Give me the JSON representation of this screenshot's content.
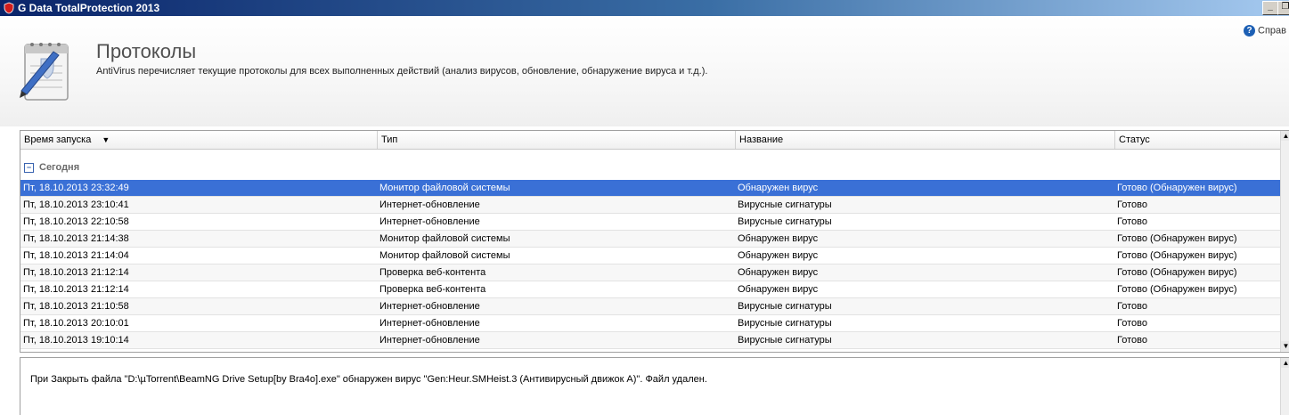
{
  "window": {
    "title": "G Data TotalProtection 2013",
    "icons": {
      "app": "gdata-shield-icon",
      "minimize": "minimize-icon",
      "restore": "restore-icon"
    }
  },
  "header": {
    "title": "Протоколы",
    "description": "AntiVirus перечисляет текущие протоколы для всех выполненных действий (анализ вирусов, обновление, обнаружение вируса и т.д.).",
    "help_label": "Справ",
    "icons": {
      "page": "log-notepad-icon",
      "help": "help-icon"
    }
  },
  "table": {
    "columns": [
      "Время запуска",
      "Тип",
      "Название",
      "Статус"
    ],
    "sorted_column": "Время запуска",
    "group": {
      "label": "Сегодня",
      "collapsed": false
    },
    "rows": [
      {
        "time": "Пт, 18.10.2013 23:32:49",
        "type": "Монитор файловой системы",
        "name": "Обнаружен вирус",
        "status": "Готово (Обнаружен вирус)"
      },
      {
        "time": "Пт, 18.10.2013 23:10:41",
        "type": "Интернет-обновление",
        "name": "Вирусные сигнатуры",
        "status": "Готово"
      },
      {
        "time": "Пт, 18.10.2013 22:10:58",
        "type": "Интернет-обновление",
        "name": "Вирусные сигнатуры",
        "status": "Готово"
      },
      {
        "time": "Пт, 18.10.2013 21:14:38",
        "type": "Монитор файловой системы",
        "name": "Обнаружен вирус",
        "status": "Готово (Обнаружен вирус)"
      },
      {
        "time": "Пт, 18.10.2013 21:14:04",
        "type": "Монитор файловой системы",
        "name": "Обнаружен вирус",
        "status": "Готово (Обнаружен вирус)"
      },
      {
        "time": "Пт, 18.10.2013 21:12:14",
        "type": "Проверка веб-контента",
        "name": "Обнаружен вирус",
        "status": "Готово (Обнаружен вирус)"
      },
      {
        "time": "Пт, 18.10.2013 21:12:14",
        "type": "Проверка веб-контента",
        "name": "Обнаружен вирус",
        "status": "Готово (Обнаружен вирус)"
      },
      {
        "time": "Пт, 18.10.2013 21:10:58",
        "type": "Интернет-обновление",
        "name": "Вирусные сигнатуры",
        "status": "Готово"
      },
      {
        "time": "Пт, 18.10.2013 20:10:01",
        "type": "Интернет-обновление",
        "name": "Вирусные сигнатуры",
        "status": "Готово"
      },
      {
        "time": "Пт, 18.10.2013 19:10:14",
        "type": "Интернет-обновление",
        "name": "Вирусные сигнатуры",
        "status": "Готово"
      }
    ],
    "selected_row": 0
  },
  "details": {
    "message": "При Закрыть файла \"D:\\µTorrent\\BeamNG Drive Setup[by Bra4o].exe\" обнаружен вирус \"Gen:Heur.SMHeist.3 (Антивирусный движок A)\". Файл удален."
  },
  "colors": {
    "selection": "#3a70d6",
    "titlebar": "#0a246a"
  }
}
